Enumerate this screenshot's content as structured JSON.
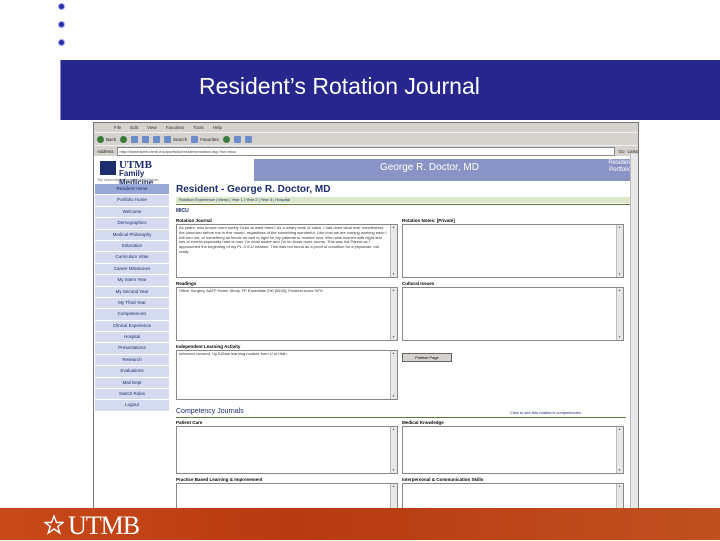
{
  "slide": {
    "title": "Resident’s Rotation Journal",
    "bullet_count": 3,
    "band_color": "#26268c",
    "footer_color": "#c0461a"
  },
  "browser": {
    "menu": [
      "File",
      "Edit",
      "View",
      "Favorites",
      "Tools",
      "Help"
    ],
    "toolbar": {
      "back_label": "Back",
      "search_label": "Search",
      "favorites_label": "Favorites"
    },
    "address_label": "Address",
    "address_value": "http://famedweb.utmb.edu/portfolio/resident/rotation.asp?rot=micu",
    "go_label": "Go",
    "links_label": "Links"
  },
  "header": {
    "logo_name": "UTMB",
    "logo_dept": "Family Medicine",
    "logo_sub": "The University of Texas Medical Branch",
    "doctor_name": "George R. Doctor, MD",
    "portfolio_label_1": "Resident",
    "portfolio_label_2": "Portfolio"
  },
  "sidebar": {
    "items": [
      "Resident Home",
      "Portfolio Home",
      "Welcome",
      "Demographics",
      "Medical Philosophy",
      "Education",
      "Curriculum Vitae",
      "Career Milestones",
      "My Intern Year",
      "My Second Year",
      "My Third Year",
      "Competencies",
      "Clinical Experience",
      "Hospital",
      "Presentations",
      "Research",
      "Evaluations",
      "Mail Dept",
      "Switch Roles",
      "Logout"
    ],
    "active_index": 0
  },
  "main": {
    "resident_title": "Resident - George R. Doctor, MD",
    "nav_text": "Rotation Experience | Menu | Year 1 | Year 2 | Year 3 | Hospital",
    "rotation_name": "MICU",
    "rotation_journal_label": "Rotation Journal",
    "rotation_journal_text": "As years, who knows more surely I'd be at least three? As a weary work of catch, I had done what ever nonetheless the unknown before me in five month, regardless of the something wonderful. Like how we are coming working each I will turn out, or something as heroic as well to right for my patients to monitor now. Who was worried with night and lots of events especially hard is now. I'm most aware and I'm on those more rooms. This was hot Parent as I approached the beginning of my PL-3 ICU rotation. This was not found as a proof of condition for a physician, but really.",
    "rotation_notes_label": "Rotation Notes: [Private]",
    "readings_label": "Readings",
    "readings_text": "Office Surgery, AAFP Home Study, FP Essentials 290 [0633]; Posttest score 92%",
    "cultural_label": "Cultural Issues",
    "ila_label": "Independent Learning Activity",
    "ila_text": "Informed consent, UpToDate learning module from U of Utah.",
    "publish_label": "Publish Page",
    "comp_journals_label": "Competency Journals",
    "comp_link_label": "Click to see this rotation's competencies",
    "comp_fields": [
      "Patient Care",
      "Medical Knowledge",
      "Practice Based Learning & Improvement",
      "Interpersonal & Communication Skills"
    ]
  },
  "footer": {
    "logo_text": "UTMB"
  }
}
